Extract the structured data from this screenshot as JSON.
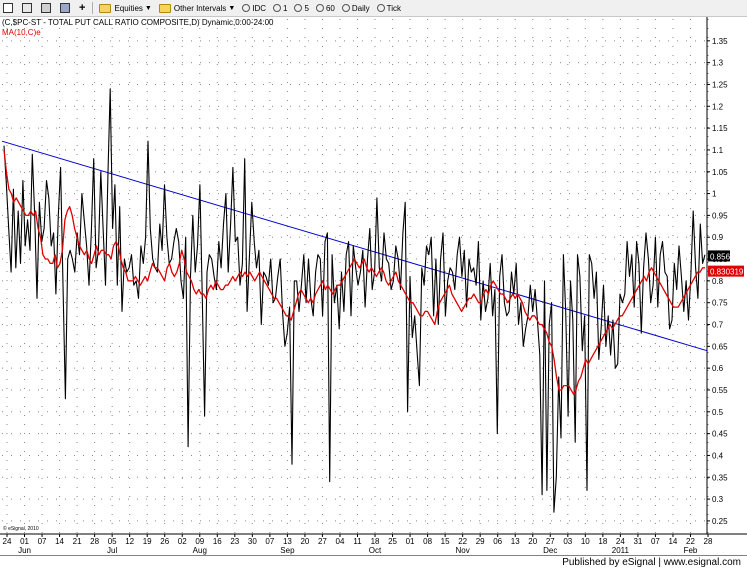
{
  "toolbar": {
    "buttons": [
      "Equities",
      "Other Intervals",
      "IDC",
      "1",
      "5",
      "60",
      "Daily",
      "Tick"
    ]
  },
  "chart_data": {
    "type": "line",
    "title": "(C,$PC-ST - TOTAL PUT CALL RATIO COMPOSITE,D) Dynamic,0:00-24:00",
    "indicator_label": "MA(10,C)e",
    "price_label": "0.856",
    "ma_label": "0.830319",
    "watermark": "© eSignal, 2010",
    "footer": "Published by eSignal | www.esignal.com",
    "ylim": [
      0.22,
      1.4
    ],
    "y_ticks": [
      1.35,
      1.3,
      1.25,
      1.2,
      1.15,
      1.1,
      1.05,
      1,
      0.95,
      0.9,
      0.85,
      0.8,
      0.75,
      0.7,
      0.65,
      0.6,
      0.55,
      0.5,
      0.45,
      0.4,
      0.35,
      0.3,
      0.25
    ],
    "y_tick_labels": [
      "1.35",
      "1.3",
      "1.25",
      "1.2",
      "1.15",
      "1.1",
      "1.05",
      "1",
      "0.95",
      "0.9",
      "0.85",
      "0.8",
      "0.75",
      "0.7",
      "0.65",
      "0.6",
      "0.55",
      "0.5",
      "0.45",
      "0.4",
      "0.35",
      "0.3",
      "0.25"
    ],
    "x_day_labels": [
      "24",
      "01",
      "07",
      "14",
      "21",
      "28",
      "05",
      "12",
      "19",
      "26",
      "02",
      "09",
      "16",
      "23",
      "30",
      "07",
      "13",
      "20",
      "27",
      "04",
      "11",
      "18",
      "25",
      "01",
      "08",
      "15",
      "22",
      "29",
      "06",
      "13",
      "20",
      "27",
      "03",
      "10",
      "18",
      "24",
      "31",
      "07",
      "14",
      "22",
      "28"
    ],
    "x_month_labels": [
      "Jun",
      "Jul",
      "Aug",
      "Sep",
      "Oct",
      "Nov",
      "Dec",
      "2011",
      "Feb"
    ],
    "x_month_label_index": [
      1,
      6,
      11,
      16,
      21,
      26,
      31,
      35,
      39
    ],
    "colors": {
      "price": "#000000",
      "ma": "#e00000",
      "trend": "#0000d0",
      "grid": "#888888"
    },
    "series": [
      {
        "style": "black",
        "values": [
          1.11,
          1.02,
          0.92,
          0.82,
          1.01,
          0.83,
          0.96,
          0.84,
          1.03,
          0.88,
          0.94,
          0.87,
          1.09,
          0.95,
          0.76,
          0.98,
          0.89,
          0.92,
          1.03,
          0.99,
          0.88,
          0.91,
          0.77,
          0.95,
          1.06,
          0.79,
          0.53,
          0.85,
          0.87,
          0.85,
          0.82,
          0.91,
          0.86,
          1.0,
          0.94,
          0.88,
          0.79,
          0.91,
          1.08,
          0.83,
          0.87,
          1.05,
          0.92,
          0.79,
          1.04,
          1.24,
          0.92,
          1.02,
          0.79,
          0.97,
          0.73,
          0.85,
          0.82,
          0.83,
          0.86,
          0.79,
          0.8,
          0.76,
          0.88,
          0.84,
          0.9,
          1.12,
          0.92,
          0.85,
          0.83,
          0.82,
          0.93,
          0.87,
          1.02,
          0.9,
          0.84,
          0.85,
          0.89,
          0.92,
          0.89,
          0.8,
          0.76,
          0.9,
          0.42,
          0.81,
          0.95,
          0.82,
          0.88,
          1.02,
          0.76,
          0.49,
          0.82,
          0.86,
          0.85,
          0.81,
          0.78,
          0.89,
          0.83,
          0.93,
          1.0,
          0.82,
          0.93,
          1.06,
          0.89,
          0.9,
          0.79,
          0.84,
          1.08,
          0.73,
          0.86,
          0.98,
          0.89,
          0.83,
          0.87,
          0.7,
          0.82,
          0.81,
          0.79,
          0.85,
          0.75,
          0.76,
          0.81,
          0.85,
          0.73,
          0.65,
          0.68,
          0.74,
          0.38,
          0.8,
          0.8,
          0.73,
          0.79,
          0.86,
          0.75,
          0.85,
          0.76,
          0.72,
          0.82,
          0.86,
          0.85,
          0.72,
          0.89,
          0.91,
          0.34,
          0.86,
          0.75,
          0.79,
          0.69,
          0.82,
          0.73,
          0.86,
          0.89,
          0.72,
          0.88,
          0.83,
          0.79,
          0.82,
          0.87,
          0.74,
          0.85,
          0.92,
          0.78,
          0.82,
          0.99,
          0.83,
          0.8,
          0.91,
          0.85,
          0.84,
          0.78,
          0.8,
          0.88,
          0.85,
          0.78,
          0.91,
          0.98,
          0.5,
          0.81,
          0.67,
          0.72,
          0.64,
          0.56,
          0.83,
          0.79,
          0.88,
          0.86,
          0.9,
          0.72,
          0.85,
          0.7,
          0.85,
          0.91,
          0.72,
          0.8,
          0.83,
          0.82,
          0.78,
          0.86,
          0.9,
          0.81,
          0.87,
          0.74,
          0.85,
          0.82,
          0.83,
          0.79,
          0.89,
          0.71,
          0.8,
          0.73,
          0.76,
          0.84,
          0.72,
          0.78,
          0.45,
          0.81,
          0.86,
          0.75,
          0.72,
          0.73,
          0.82,
          0.77,
          0.84,
          0.7,
          0.75,
          0.65,
          0.69,
          0.72,
          0.79,
          0.73,
          0.78,
          0.71,
          0.63,
          0.31,
          0.8,
          0.32,
          0.7,
          0.75,
          0.27,
          0.35,
          0.58,
          0.44,
          0.86,
          0.73,
          0.49,
          0.8,
          0.71,
          0.43,
          0.86,
          0.81,
          0.64,
          0.72,
          0.32,
          0.86,
          0.84,
          0.76,
          0.82,
          0.62,
          0.69,
          0.79,
          0.65,
          0.72,
          0.63,
          0.71,
          0.6,
          0.61,
          0.77,
          0.75,
          0.77,
          0.89,
          0.81,
          0.86,
          0.74,
          0.89,
          0.84,
          0.68,
          0.83,
          0.91,
          0.85,
          0.75,
          0.79,
          0.9,
          0.74,
          0.86,
          0.89,
          0.82,
          0.81,
          0.69,
          0.71,
          0.84,
          0.78,
          0.88,
          0.81,
          0.73,
          0.8,
          0.71,
          0.81,
          0.96,
          0.83,
          0.76,
          0.93,
          0.84,
          0.86
        ]
      },
      {
        "style": "red",
        "values": [
          1.1,
          1.05,
          1.01,
          1.0,
          0.98,
          0.99,
          0.98,
          0.97,
          0.96,
          0.95,
          0.95,
          0.96,
          0.95,
          0.96,
          0.92,
          0.9,
          0.86,
          0.85,
          0.85,
          0.84,
          0.84,
          0.86,
          0.83,
          0.84,
          0.87,
          0.94,
          0.96,
          0.97,
          0.95,
          0.92,
          0.9,
          0.88,
          0.87,
          0.86,
          0.87,
          0.85,
          0.84,
          0.86,
          0.88,
          0.86,
          0.87,
          0.87,
          0.86,
          0.86,
          0.85,
          0.88,
          0.89,
          0.88,
          0.85,
          0.83,
          0.82,
          0.8,
          0.8,
          0.8,
          0.81,
          0.8,
          0.79,
          0.8,
          0.81,
          0.8,
          0.82,
          0.84,
          0.83,
          0.83,
          0.82,
          0.81,
          0.8,
          0.83,
          0.84,
          0.82,
          0.81,
          0.82,
          0.84,
          0.87,
          0.85,
          0.82,
          0.81,
          0.8,
          0.78,
          0.77,
          0.78,
          0.77,
          0.77,
          0.76,
          0.78,
          0.79,
          0.78,
          0.8,
          0.79,
          0.78,
          0.78,
          0.79,
          0.79,
          0.8,
          0.81,
          0.8,
          0.81,
          0.82,
          0.81,
          0.82,
          0.81,
          0.82,
          0.81,
          0.8,
          0.81,
          0.82,
          0.81,
          0.8,
          0.79,
          0.78,
          0.77,
          0.76,
          0.76,
          0.75,
          0.74,
          0.73,
          0.72,
          0.72,
          0.71,
          0.73,
          0.75,
          0.77,
          0.78,
          0.77,
          0.76,
          0.75,
          0.76,
          0.75,
          0.77,
          0.78,
          0.79,
          0.8,
          0.78,
          0.79,
          0.78,
          0.77,
          0.78,
          0.79,
          0.79,
          0.8,
          0.81,
          0.82,
          0.83,
          0.84,
          0.85,
          0.84,
          0.83,
          0.84,
          0.85,
          0.83,
          0.82,
          0.83,
          0.82,
          0.81,
          0.82,
          0.83,
          0.82,
          0.8,
          0.79,
          0.8,
          0.81,
          0.82,
          0.8,
          0.79,
          0.78,
          0.77,
          0.76,
          0.75,
          0.75,
          0.74,
          0.73,
          0.72,
          0.72,
          0.73,
          0.73,
          0.72,
          0.71,
          0.7,
          0.73,
          0.75,
          0.76,
          0.77,
          0.78,
          0.79,
          0.77,
          0.76,
          0.75,
          0.74,
          0.73,
          0.74,
          0.75,
          0.76,
          0.76,
          0.77,
          0.76,
          0.75,
          0.75,
          0.77,
          0.78,
          0.77,
          0.79,
          0.8,
          0.79,
          0.78,
          0.77,
          0.77,
          0.76,
          0.75,
          0.76,
          0.77,
          0.76,
          0.77,
          0.76,
          0.75,
          0.73,
          0.72,
          0.71,
          0.72,
          0.72,
          0.71,
          0.7,
          0.7,
          0.69,
          0.68,
          0.66,
          0.65,
          0.62,
          0.58,
          0.55,
          0.55,
          0.56,
          0.56,
          0.56,
          0.55,
          0.54,
          0.55,
          0.57,
          0.58,
          0.6,
          0.62,
          0.61,
          0.62,
          0.63,
          0.64,
          0.65,
          0.66,
          0.67,
          0.68,
          0.69,
          0.7,
          0.69,
          0.7,
          0.71,
          0.72,
          0.72,
          0.73,
          0.74,
          0.75,
          0.76,
          0.77,
          0.78,
          0.79,
          0.8,
          0.81,
          0.8,
          0.82,
          0.83,
          0.82,
          0.81,
          0.8,
          0.79,
          0.78,
          0.77,
          0.76,
          0.75,
          0.74,
          0.74,
          0.74,
          0.75,
          0.76,
          0.77,
          0.78,
          0.79,
          0.8,
          0.81,
          0.82,
          0.82,
          0.83,
          0.83
        ]
      }
    ],
    "trendline": [
      [
        0,
        1.12
      ],
      [
        1,
        0.64
      ]
    ]
  }
}
